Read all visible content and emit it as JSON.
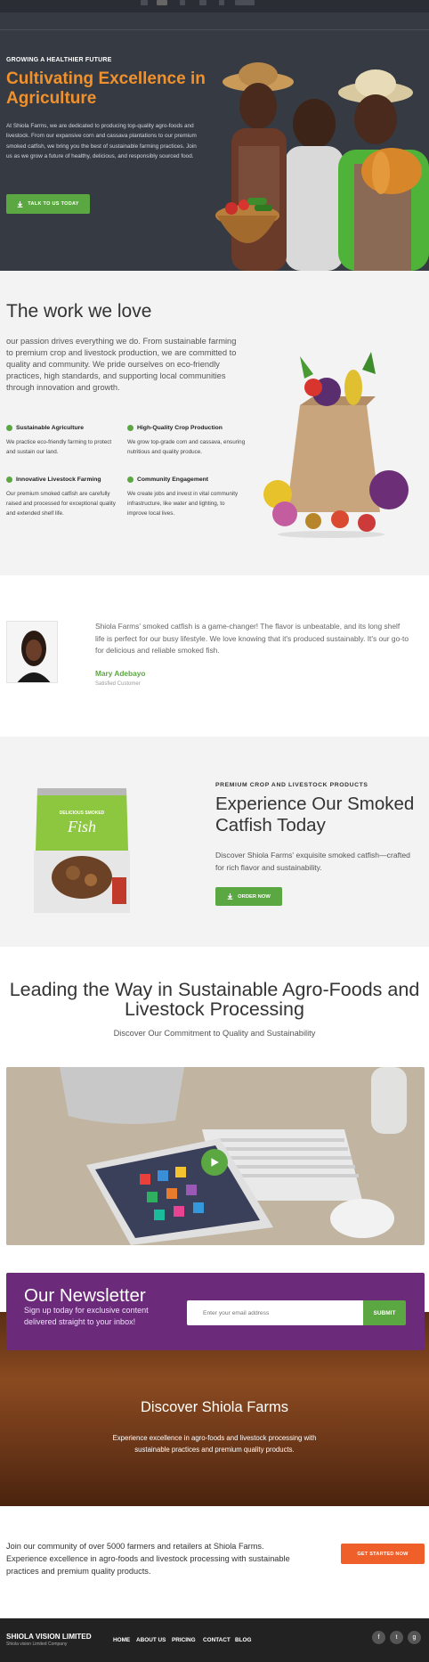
{
  "hero": {
    "kicker_prefix": "GROWING A HEALTHIER ",
    "kicker_bold": "FUTURE",
    "title": "Cultivating Excellence in Agriculture",
    "text": "At Shiola Farms, we are dedicated to producing top-quality agro-foods and livestock. From our expansive corn and cassava plantations to our premium smoked catfish, we bring you the best of sustainable farming practices. Join us as we grow a future of healthy, delicious, and responsibly sourced food.",
    "button": "TALK TO US TODAY"
  },
  "work": {
    "title": "The work we love",
    "text": "our passion drives everything we do. From sustainable farming to premium crop and livestock production, we are committed to quality and community. We pride ourselves on eco-friendly practices, high standards, and supporting local communities through innovation and growth.",
    "features": [
      {
        "title": "Sustainable Agriculture",
        "text": "We practice eco-friendly farming to protect and sustain our land."
      },
      {
        "title": "High-Quality Crop Production",
        "text": "We grow top-grade corn and cassava, ensuring nutritious and quality produce."
      },
      {
        "title": "Innovative Livestock Farming",
        "text": "Our premium smoked catfish are carefully raised and processed for exceptional quality and extended shelf life."
      },
      {
        "title": "Community Engagement",
        "text": "We create jobs and invest in vital community infrastructure, like water and lighting, to improve local lives."
      }
    ]
  },
  "testimonial": {
    "quote": "Shiola Farms' smoked catfish is a game-changer! The flavor is unbeatable, and its long shelf life is perfect for our busy lifestyle. We love knowing that it's produced sustainably. It's our go-to for delicious and reliable smoked fish.",
    "name": "Mary Adebayo",
    "role": "Satisfied Customer"
  },
  "catfish": {
    "kicker": "PREMIUM CROP AND LIVESTOCK PRODUCTS",
    "title": "Experience Our Smoked Catfish Today",
    "text": "Discover Shiola Farms' exquisite smoked catfish—crafted for rich flavor and sustainability.",
    "button": "ORDER NOW",
    "pack_small": "DELICIOUS SMOKED",
    "pack_big": "Fish"
  },
  "leading": {
    "title": "Leading the Way in Sustainable Agro-Foods and Livestock Processing",
    "subtitle": "Discover Our Commitment to Quality and Sustainability"
  },
  "newsletter": {
    "title": "Our Newsletter",
    "subtitle": "Sign up today for exclusive content delivered straight to your inbox!",
    "placeholder": "Enter your email address",
    "button": "SUBMIT"
  },
  "discover": {
    "title": "Discover Shiola Farms",
    "text": "Experience excellence in agro-foods and livestock processing with sustainable practices and premium quality products."
  },
  "community": {
    "text": "Join our community of over 5000 farmers and retailers at Shiola Farms. Experience excellence in agro-foods and livestock processing with sustainable practices and premium quality products.",
    "button": "GET STARTED NOW"
  },
  "footer": {
    "brand": "SHIOLA VISION LIMITED",
    "copy": "Shiola vision Limited Company",
    "nav": [
      "HOME",
      "ABOUT US",
      "PRICING",
      "CONTACT",
      "BLOG"
    ],
    "social": [
      "facebook-icon",
      "twitter-icon",
      "google-plus-icon"
    ]
  },
  "colors": {
    "accent_green": "#5ba741",
    "hero_orange": "#f0912c",
    "newsletter_purple": "#6b2a7a",
    "cta_orange": "#ee5f2a"
  }
}
